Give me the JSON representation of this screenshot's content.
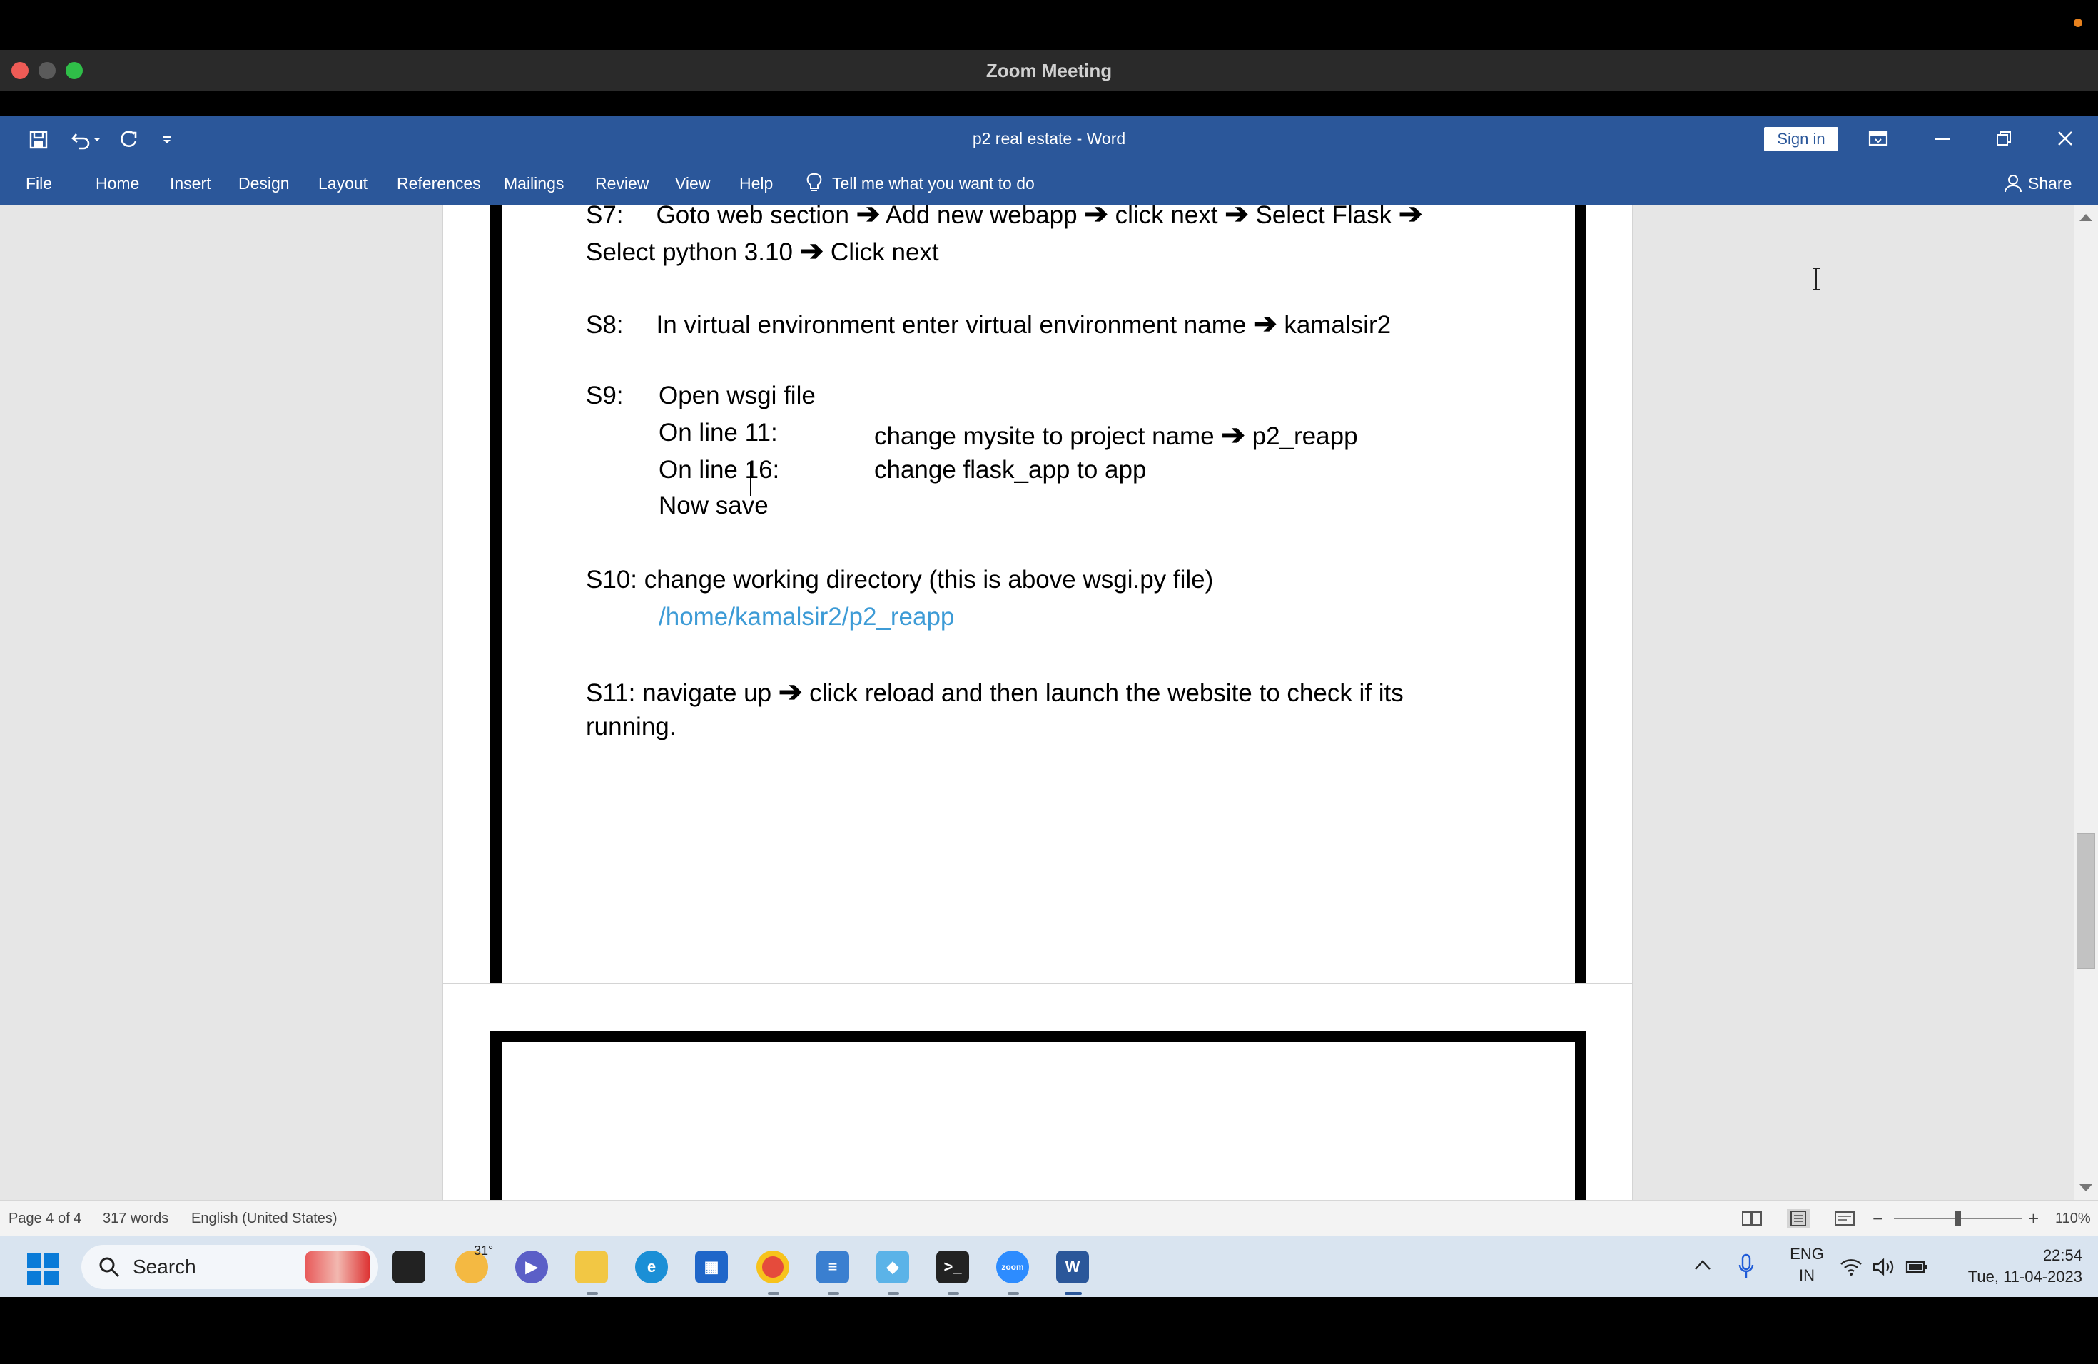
{
  "zoom": {
    "window_title": "Zoom Meeting",
    "traffic_colors": [
      "#ee5b56",
      "#5a5a5a",
      "#2fbe48"
    ]
  },
  "word": {
    "doc_title": "p2 real estate  -  Word",
    "sign_in": "Sign in",
    "tabs": [
      "File",
      "Home",
      "Insert",
      "Design",
      "Layout",
      "References",
      "Mailings",
      "Review",
      "View",
      "Help"
    ],
    "tell_me": "Tell me what you want to do",
    "share": "Share",
    "accent": "#2b579a"
  },
  "document": {
    "s7_label": "S7:",
    "s7_text": "Goto web section",
    "s7_b": "Add new webapp",
    "s7_c": "click next",
    "s7_d": "Select Flask",
    "s7_line2a": "Select python 3.10",
    "s7_line2b": "Click next",
    "s8_label": "S8:",
    "s8_text": "In virtual environment enter virtual environment name",
    "s8_value": "kamalsir2",
    "s9_label": "S9:",
    "s9_text": "Open wsgi file",
    "s9_l11": "On line 11:",
    "s9_l11_action": "change mysite to project name",
    "s9_l11_value": "p2_reapp",
    "s9_l16": "On line 16:",
    "s9_l16_action": "change flask_app to app",
    "s9_save": "Now save",
    "s10_text": "S10: change working directory  (this is above wsgi.py file)",
    "s10_path": "/home/kamalsir2/p2_reapp",
    "s11_text_a": "S11: navigate up",
    "s11_text_b": "click reload and then launch the website to check if its",
    "s11_line2": "running."
  },
  "status": {
    "page": "Page 4 of 4",
    "words": "317 words",
    "language": "English (United States)",
    "zoom": "110%"
  },
  "taskbar": {
    "search": "Search",
    "weather": "31°",
    "lang_top": "ENG",
    "lang_bottom": "IN",
    "time": "22:54",
    "date": "Tue, 11-04-2023"
  }
}
